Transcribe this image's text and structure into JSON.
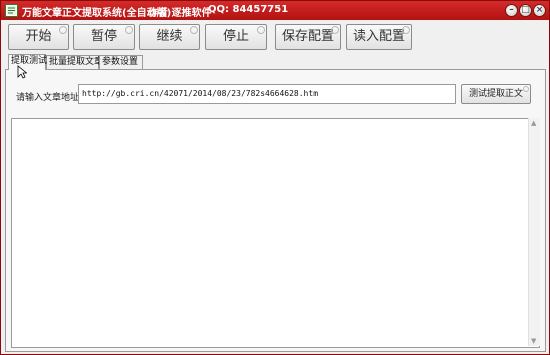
{
  "window": {
    "title": "万能文章正文提取系统(全自动版)",
    "author": "作者 逐推软件",
    "qq": "QQ:  84457751",
    "accent_color": "#c01818"
  },
  "controls": {
    "minimize": "–",
    "maximize": "□",
    "close": "×"
  },
  "toolbar": {
    "start": "开始",
    "pause": "暂停",
    "resume": "继续",
    "stop": "停止",
    "save_config": "保存配置",
    "load_config": "读入配置"
  },
  "tabs": [
    {
      "label": "提取测试",
      "active": true
    },
    {
      "label": "批量提取文章",
      "active": false
    },
    {
      "label": "参数设置",
      "active": false
    }
  ],
  "extract_test": {
    "url_label": "请输入文章地址:",
    "url_value": "http://gb.cri.cn/42071/2014/08/23/782s4664628.htm",
    "test_button": "测试提取正文",
    "result_text": ""
  },
  "icons": {
    "app": "app-logo-icon",
    "scroll_up": "scroll-up-arrow-icon",
    "scroll_down": "scroll-down-arrow-icon",
    "cursor": "mouse-cursor-icon"
  }
}
